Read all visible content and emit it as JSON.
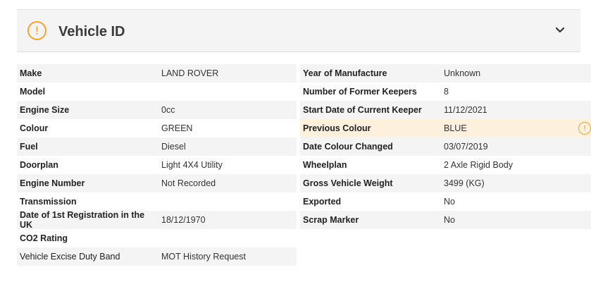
{
  "header": {
    "title": "Vehicle ID",
    "warning_icon": "exclamation-circle-icon",
    "chevron_icon": "chevron-down-icon",
    "accent_color": "#f0a233"
  },
  "left": [
    {
      "label": "Make",
      "value": "LAND ROVER"
    },
    {
      "label": "Model",
      "value": ""
    },
    {
      "label": "Engine Size",
      "value": "0cc"
    },
    {
      "label": "Colour",
      "value": "GREEN"
    },
    {
      "label": "Fuel",
      "value": "Diesel"
    },
    {
      "label": "Doorplan",
      "value": "Light 4X4 Utility"
    },
    {
      "label": "Engine Number",
      "value": "Not Recorded"
    },
    {
      "label": "Transmission",
      "value": ""
    },
    {
      "label": "Date of 1st Registration in the UK",
      "value": "18/12/1970"
    },
    {
      "label": "CO2 Rating",
      "value": ""
    },
    {
      "label": "Vehicle Excise Duty Band",
      "value": "MOT History Request"
    }
  ],
  "right": [
    {
      "label": "Year of Manufacture",
      "value": "Unknown"
    },
    {
      "label": "Number of Former Keepers",
      "value": "8"
    },
    {
      "label": "Start Date of Current Keeper",
      "value": "11/12/2021"
    },
    {
      "label": "Previous Colour",
      "value": "BLUE"
    },
    {
      "label": "Date Colour Changed",
      "value": "03/07/2019"
    },
    {
      "label": "Wheelplan",
      "value": "2 Axle Rigid Body"
    },
    {
      "label": "Gross Vehicle Weight",
      "value": "3499 (KG)"
    },
    {
      "label": "Exported",
      "value": "No"
    },
    {
      "label": "Scrap Marker",
      "value": "No"
    }
  ],
  "link_color": "#e26d0e",
  "warn_row_color": "#fdf1dd"
}
